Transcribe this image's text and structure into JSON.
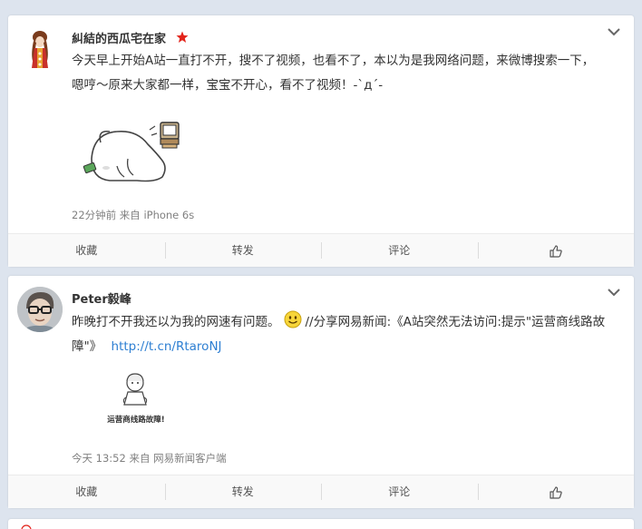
{
  "posts": [
    {
      "author": "糾結的西瓜宅在家",
      "text_line1": "今天早上开始A站一直打不开，搜不了视频，也看不了，本以为是我网络问题，来微博搜索一下，",
      "text_line2": "嗯哼～原来大家都一样，宝宝不开心，看不了视频！-`д´-",
      "meta": "22分钟前 来自 iPhone 6s",
      "actions": {
        "collect": "收藏",
        "repost": "转发",
        "comment": "评论"
      }
    },
    {
      "author": "Peter毅峰",
      "text_a": "昨晚打不开我还以为我的网速有问题。",
      "text_b": "//分享网易新闻:《A站突然无法访问:提示\"运营商线路故",
      "text_c": "障\"》",
      "link": "http://t.cn/RtaroNJ",
      "image_caption": "运营商线路故障!",
      "meta": "今天 13:52 来自 网易新闻客户端",
      "actions": {
        "collect": "收藏",
        "repost": "转发",
        "comment": "评论"
      }
    }
  ],
  "colors": {
    "background": "#dde4ee",
    "card": "#ffffff",
    "link": "#2e7fd2",
    "verified_star": "#e2231a"
  },
  "icons": [
    "avatar",
    "star-icon",
    "chevron-down-icon",
    "thumbs-up-icon",
    "smiley-emoji",
    "calendar-icon"
  ]
}
